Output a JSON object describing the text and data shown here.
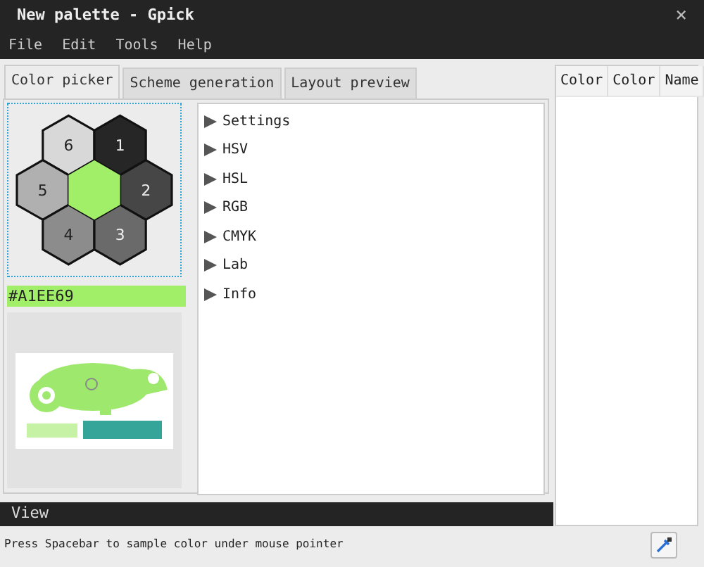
{
  "window": {
    "title": "New palette - Gpick",
    "close": "×"
  },
  "menu": [
    "File",
    "Edit",
    "Tools",
    "Help"
  ],
  "tabs": [
    {
      "label": "Color picker",
      "selected": true
    },
    {
      "label": "Scheme generation",
      "selected": false
    },
    {
      "label": "Layout preview",
      "selected": false
    }
  ],
  "swatches": {
    "center": {
      "color": "#a1ee69"
    },
    "cells": [
      {
        "label": "6",
        "color": "#d8d8d8"
      },
      {
        "label": "1",
        "color": "#262626"
      },
      {
        "label": "5",
        "color": "#b0b0b0"
      },
      {
        "label": "2",
        "color": "#464646"
      },
      {
        "label": "4",
        "color": "#8c8c8c"
      },
      {
        "label": "3",
        "color": "#6a6a6a"
      }
    ]
  },
  "color_value": "#A1EE69",
  "sections": [
    {
      "label": "Settings",
      "expanded": false
    },
    {
      "label": "HSV",
      "expanded": false
    },
    {
      "label": "HSL",
      "expanded": false
    },
    {
      "label": "RGB",
      "expanded": false
    },
    {
      "label": "CMYK",
      "expanded": false
    },
    {
      "label": "Lab",
      "expanded": false
    },
    {
      "label": "Info",
      "expanded": false
    }
  ],
  "palette": {
    "columns": [
      "Color",
      "Color",
      "Name"
    ]
  },
  "view_bar": "View",
  "status_bar": "Press Spacebar to sample color under mouse pointer"
}
